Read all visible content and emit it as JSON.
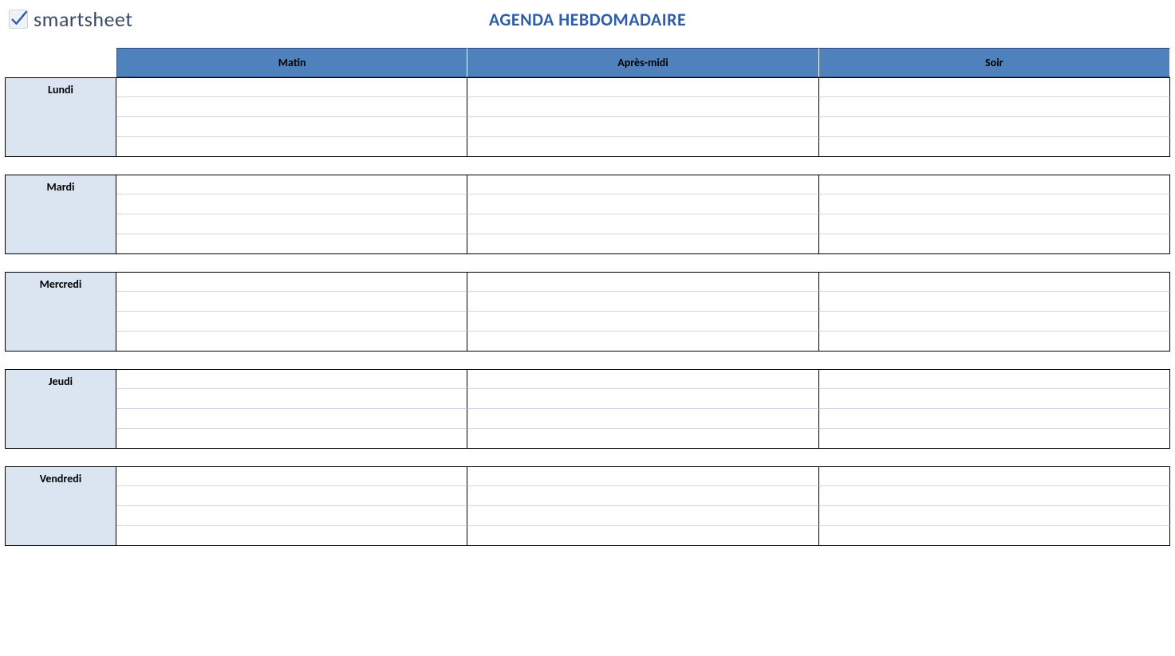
{
  "brand": {
    "name": "smartsheet"
  },
  "title": "AGENDA HEBDOMADAIRE",
  "columns": [
    "Matin",
    "Après-midi",
    "Soir"
  ],
  "days": [
    {
      "name": "Lundi",
      "rows": [
        "",
        "",
        "",
        ""
      ]
    },
    {
      "name": "Mardi",
      "rows": [
        "",
        "",
        "",
        ""
      ]
    },
    {
      "name": "Mercredi",
      "rows": [
        "",
        "",
        "",
        ""
      ]
    },
    {
      "name": "Jeudi",
      "rows": [
        "",
        "",
        "",
        ""
      ]
    },
    {
      "name": "Vendredi",
      "rows": [
        "",
        "",
        "",
        ""
      ]
    }
  ]
}
